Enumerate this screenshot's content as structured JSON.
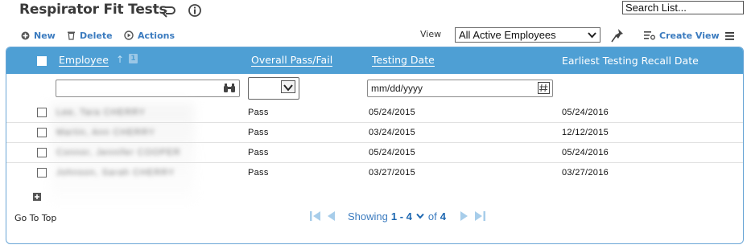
{
  "header": {
    "title": "Respirator Fit Tests"
  },
  "search": {
    "value": "Search List..."
  },
  "toolbar": {
    "new_label": "New",
    "delete_label": "Delete",
    "actions_label": "Actions",
    "view_label": "View",
    "view_selected": "All Active Employees",
    "create_view_label": "Create View"
  },
  "table": {
    "columns": {
      "employee": "Employee",
      "pass_fail": "Overall Pass/Fail",
      "testing_date": "Testing Date",
      "recall_date": "Earliest Testing Recall Date"
    },
    "sort_badge": "1",
    "date_placeholder": "mm/dd/yyyy",
    "rows": [
      {
        "employee": "Lee, Tara  CHERRY",
        "pass_fail": "Pass",
        "testing_date": "05/24/2015",
        "recall_date": "05/24/2016"
      },
      {
        "employee": "Martin, Ann  CHERRY",
        "pass_fail": "Pass",
        "testing_date": "03/24/2015",
        "recall_date": "12/12/2015"
      },
      {
        "employee": "Connor, Jennifer  COOPER",
        "pass_fail": "Pass",
        "testing_date": "05/24/2015",
        "recall_date": "05/24/2016"
      },
      {
        "employee": "Johnson, Sarah  CHERRY",
        "pass_fail": "Pass",
        "testing_date": "03/27/2015",
        "recall_date": "03/27/2016"
      }
    ]
  },
  "footer": {
    "go_top": "Go To Top",
    "showing_label": "Showing",
    "range": "1 - 4",
    "of_label": "of",
    "total": "4"
  },
  "colors": {
    "accent": "#4e9fd4",
    "link": "#3b7bbf"
  }
}
